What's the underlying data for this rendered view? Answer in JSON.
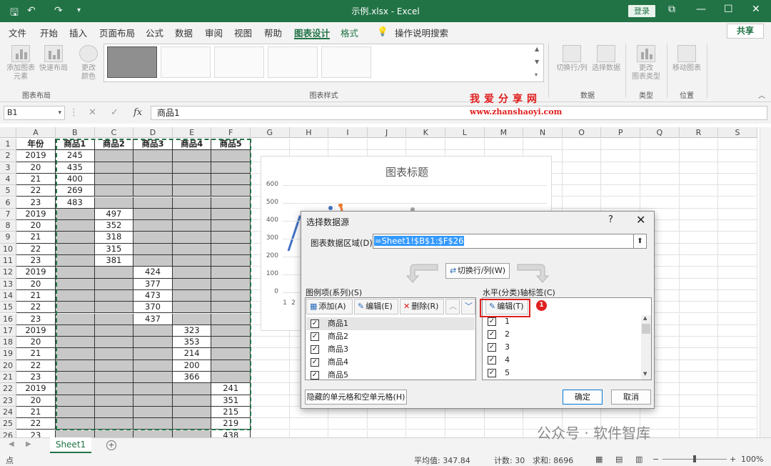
{
  "titlebar": {
    "title": "示例.xlsx  -  Excel",
    "login": "登录"
  },
  "menu": {
    "items": [
      "文件",
      "开始",
      "插入",
      "页面布局",
      "公式",
      "数据",
      "审阅",
      "视图",
      "帮助",
      "图表设计",
      "格式"
    ],
    "active": "图表设计",
    "tell_me": "操作说明搜索",
    "share": "共享"
  },
  "ribbon": {
    "add_element": "添加图表\n元素",
    "quick_layout": "快速布局",
    "change_colors": "更改\n颜色",
    "group_layout": "图表布局",
    "group_styles": "图表样式",
    "switch_rowcol": "切换行/列",
    "select_data": "选择数据",
    "group_data": "数据",
    "change_type": "更改\n图表类型",
    "group_type": "类型",
    "move_chart": "移动图表",
    "group_location": "位置"
  },
  "formulabar": {
    "namebox": "B1",
    "fx": "fx",
    "content": "商品1"
  },
  "sheet": {
    "columns": [
      "A",
      "B",
      "C",
      "D",
      "E",
      "F",
      "G",
      "H",
      "I",
      "J",
      "K",
      "L",
      "M",
      "N",
      "O",
      "P",
      "Q",
      "R",
      "S"
    ],
    "headers": [
      "年份",
      "商品1",
      "商品2",
      "商品3",
      "商品4",
      "商品5"
    ],
    "years": [
      "2019",
      "20",
      "21",
      "22",
      "23",
      "2019",
      "20",
      "21",
      "22",
      "23",
      "2019",
      "20",
      "21",
      "22",
      "23",
      "2019",
      "20",
      "21",
      "22",
      "23",
      "2019",
      "20",
      "21",
      "22",
      "23"
    ],
    "product_values": [
      [
        "245",
        "435",
        "400",
        "269",
        "483"
      ],
      [
        "497",
        "352",
        "318",
        "315",
        "381"
      ],
      [
        "424",
        "377",
        "473",
        "370",
        "437"
      ],
      [
        "323",
        "353",
        "214",
        "200",
        "366"
      ],
      [
        "241",
        "351",
        "215",
        "219",
        "438"
      ]
    ]
  },
  "chart": {
    "title": "图表标题",
    "yticks": [
      "600",
      "500",
      "400",
      "300",
      "200",
      "100",
      "0"
    ],
    "xticks": [
      "1",
      "2"
    ]
  },
  "watermark": {
    "site_cn": "我爱分享网",
    "site_url": "www.zhanshaoyi.com",
    "account": "公众号 · 软件智库"
  },
  "dialog": {
    "title": "选择数据源",
    "help": "?",
    "close": "✕",
    "range_label": "图表数据区域(D):",
    "range_value": "=Sheet1!$B$1:$F$26",
    "switch": "切换行/列(W)",
    "legend_label": "图例项(系列)(S)",
    "axis_label": "水平(分类)轴标签(C)",
    "add": "添加(A)",
    "edit": "编辑(E)",
    "remove": "删除(R)",
    "axis_edit": "编辑(T)",
    "series": [
      "商品1",
      "商品2",
      "商品3",
      "商品4",
      "商品5"
    ],
    "categories": [
      "1",
      "2",
      "3",
      "4",
      "5"
    ],
    "hidden_cells": "隐藏的单元格和空单元格(H)",
    "ok": "确定",
    "cancel": "取消",
    "badge": "1"
  },
  "tabs": {
    "sheet": "Sheet1",
    "add": "+"
  },
  "status": {
    "mode": "点",
    "average": "平均值: 347.84",
    "count": "计数: 30",
    "sum": "求和: 8696",
    "zoom": "100%"
  }
}
